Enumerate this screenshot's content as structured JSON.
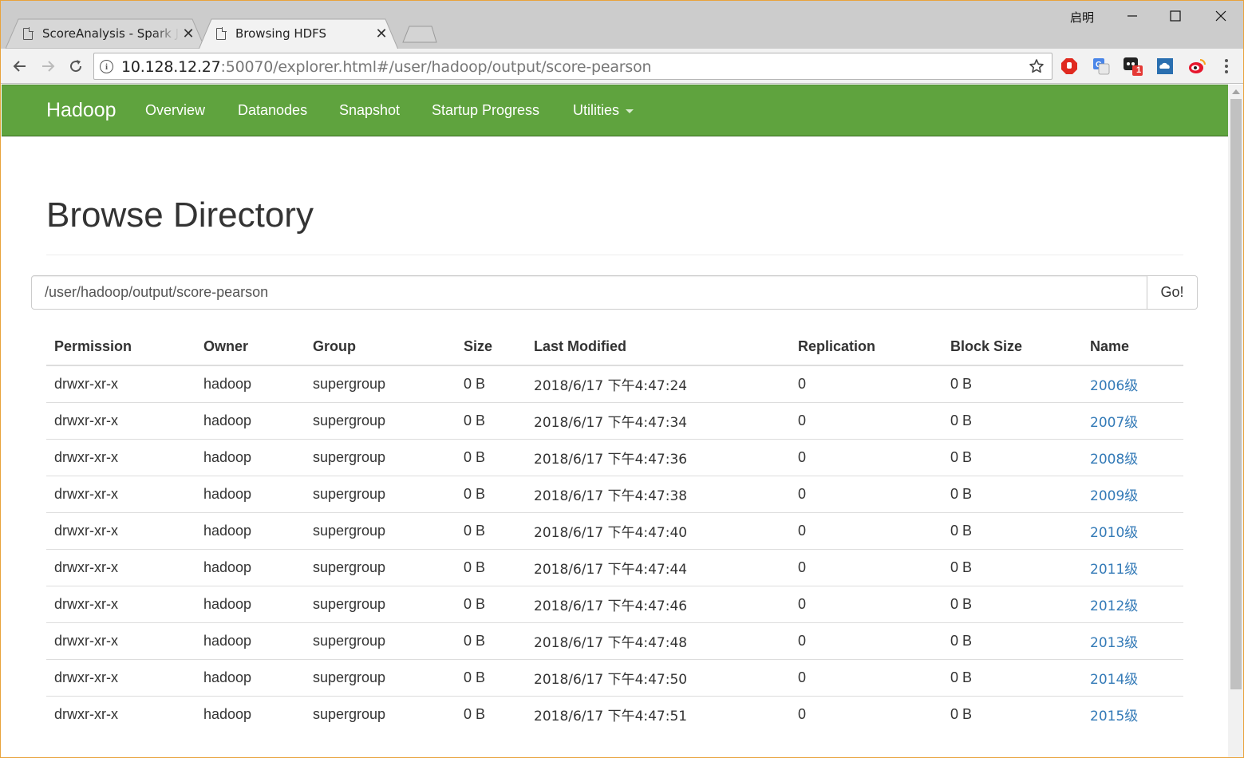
{
  "browser": {
    "tabs": [
      {
        "title": "ScoreAnalysis - Spark Jobs",
        "active": false
      },
      {
        "title": "Browsing HDFS",
        "active": true
      }
    ],
    "window_user": "启明",
    "url_host": "10.128.12.27",
    "url_rest": ":50070/explorer.html#/user/hadoop/output/score-pearson",
    "extension_badge": "1"
  },
  "navbar": {
    "brand": "Hadoop",
    "items": [
      "Overview",
      "Datanodes",
      "Snapshot",
      "Startup Progress",
      "Utilities"
    ],
    "color": "#5fa33e"
  },
  "page": {
    "title": "Browse Directory",
    "path_value": "/user/hadoop/output/score-pearson",
    "go_label": "Go!"
  },
  "table": {
    "headers": [
      "Permission",
      "Owner",
      "Group",
      "Size",
      "Last Modified",
      "Replication",
      "Block Size",
      "Name"
    ],
    "rows": [
      [
        "drwxr-xr-x",
        "hadoop",
        "supergroup",
        "0 B",
        "2018/6/17 下午4:47:24",
        "0",
        "0 B",
        "2006级"
      ],
      [
        "drwxr-xr-x",
        "hadoop",
        "supergroup",
        "0 B",
        "2018/6/17 下午4:47:34",
        "0",
        "0 B",
        "2007级"
      ],
      [
        "drwxr-xr-x",
        "hadoop",
        "supergroup",
        "0 B",
        "2018/6/17 下午4:47:36",
        "0",
        "0 B",
        "2008级"
      ],
      [
        "drwxr-xr-x",
        "hadoop",
        "supergroup",
        "0 B",
        "2018/6/17 下午4:47:38",
        "0",
        "0 B",
        "2009级"
      ],
      [
        "drwxr-xr-x",
        "hadoop",
        "supergroup",
        "0 B",
        "2018/6/17 下午4:47:40",
        "0",
        "0 B",
        "2010级"
      ],
      [
        "drwxr-xr-x",
        "hadoop",
        "supergroup",
        "0 B",
        "2018/6/17 下午4:47:44",
        "0",
        "0 B",
        "2011级"
      ],
      [
        "drwxr-xr-x",
        "hadoop",
        "supergroup",
        "0 B",
        "2018/6/17 下午4:47:46",
        "0",
        "0 B",
        "2012级"
      ],
      [
        "drwxr-xr-x",
        "hadoop",
        "supergroup",
        "0 B",
        "2018/6/17 下午4:47:48",
        "0",
        "0 B",
        "2013级"
      ],
      [
        "drwxr-xr-x",
        "hadoop",
        "supergroup",
        "0 B",
        "2018/6/17 下午4:47:50",
        "0",
        "0 B",
        "2014级"
      ],
      [
        "drwxr-xr-x",
        "hadoop",
        "supergroup",
        "0 B",
        "2018/6/17 下午4:47:51",
        "0",
        "0 B",
        "2015级"
      ]
    ]
  }
}
